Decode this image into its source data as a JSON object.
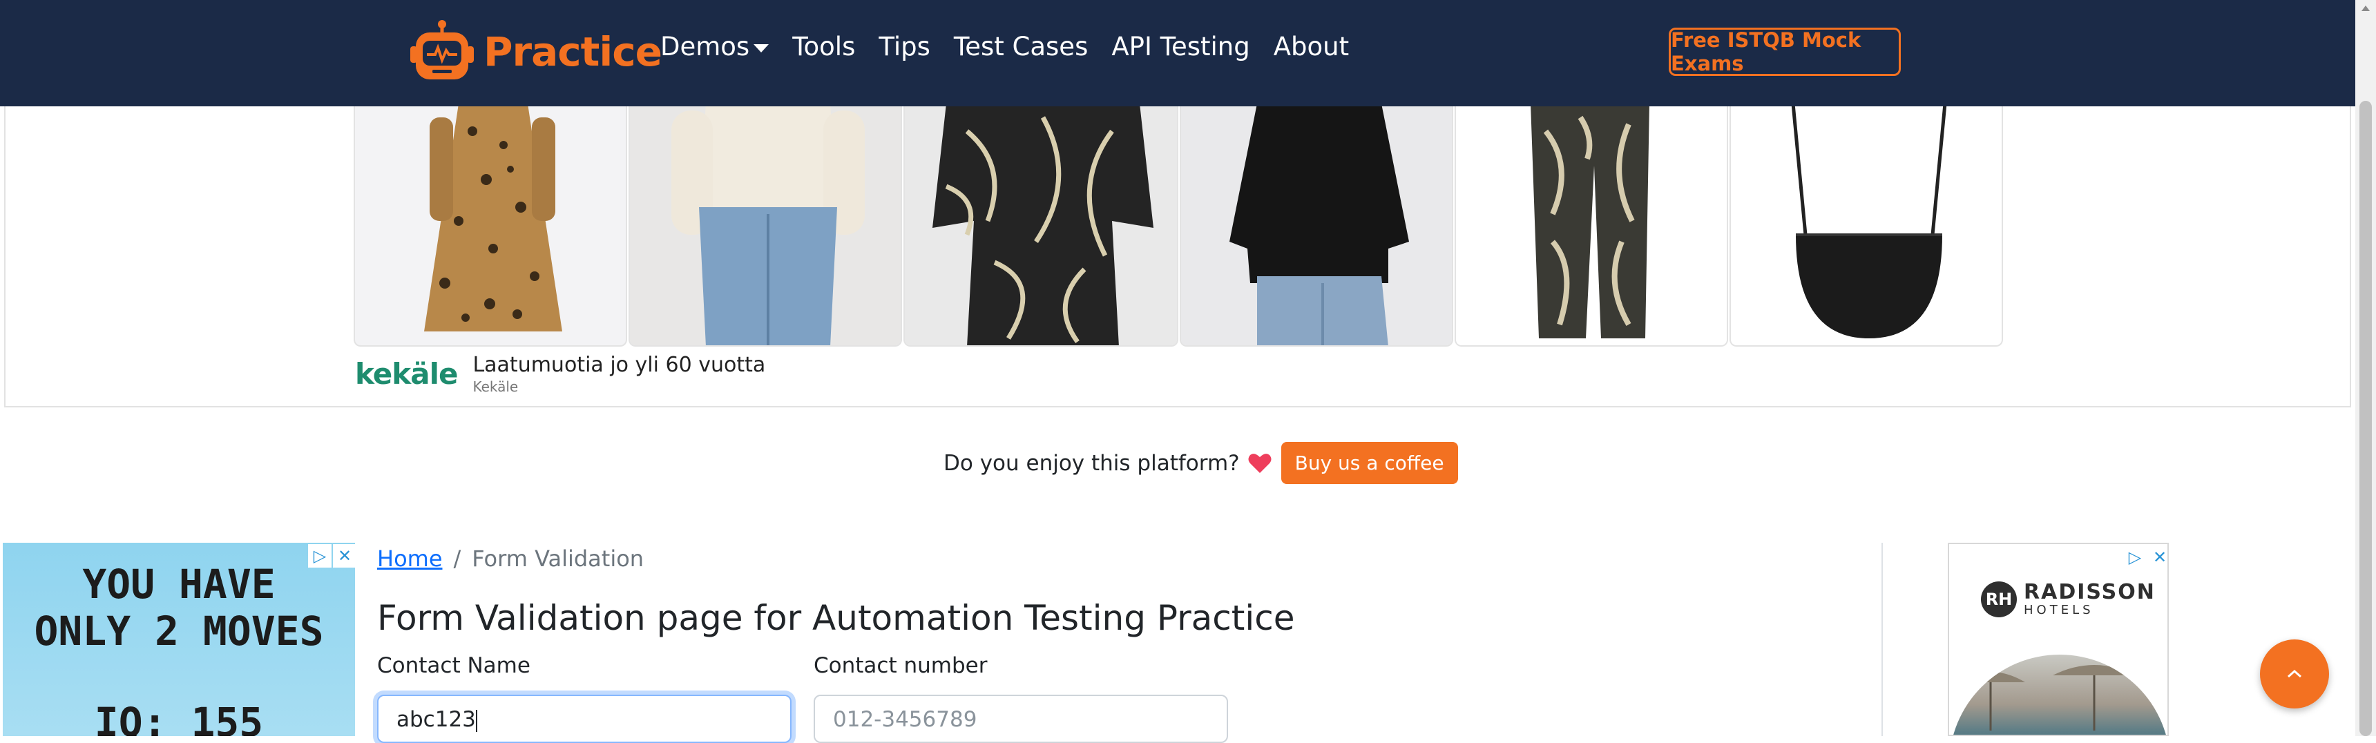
{
  "navbar": {
    "brand": "Practice",
    "items": [
      {
        "label": "Demos",
        "dropdown": true
      },
      {
        "label": "Tools"
      },
      {
        "label": "Tips"
      },
      {
        "label": "Test Cases"
      },
      {
        "label": "API Testing"
      },
      {
        "label": "About"
      }
    ],
    "cta": "Free ISTQB Mock Exams",
    "colors": {
      "background": "#1b2a47",
      "accent": "#f37121"
    }
  },
  "top_ad": {
    "products": [
      "leopard-print-dress",
      "cream-knit-sweater-denim-skirt",
      "leaf-print-tunic",
      "black-sweater-jeans",
      "palm-print-trousers",
      "black-crossbody-bag"
    ],
    "logo": "kekäle",
    "title": "Laatumuotia jo yli 60 vuotta",
    "advertiser": "Kekäle"
  },
  "coffee": {
    "question": "Do you enjoy this platform?",
    "icon": "heart-icon",
    "button": "Buy us a coffee"
  },
  "left_ad": {
    "line1": "YOU HAVE",
    "line2": "ONLY 2 MOVES",
    "line3": "IQ: 155"
  },
  "right_ad": {
    "brand": "RADISSON",
    "sub": "HOTELS",
    "mark": "RH"
  },
  "breadcrumb": {
    "home": "Home",
    "separator": "/",
    "current": "Form Validation"
  },
  "main": {
    "title": "Form Validation page for Automation Testing Practice",
    "contact_name": {
      "label": "Contact Name",
      "value": "abc123"
    },
    "contact_number": {
      "label": "Contact number",
      "placeholder": "012-3456789"
    }
  },
  "fab": {
    "icon": "chevron-up-icon"
  }
}
